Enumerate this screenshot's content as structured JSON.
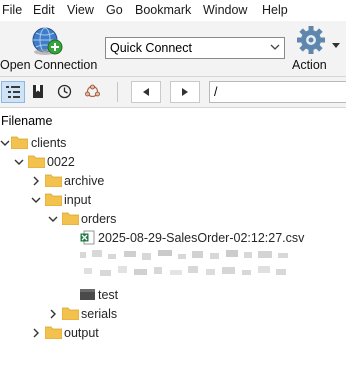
{
  "menu": [
    "File",
    "Edit",
    "View",
    "Go",
    "Bookmark",
    "Window",
    "Help"
  ],
  "toolbar": {
    "open_connection_label": "Open Connection",
    "quick_connect_value": "Quick Connect",
    "action_label": "Action"
  },
  "navigation": {
    "path_value": "/"
  },
  "browser": {
    "column_header": "Filename",
    "tree": [
      {
        "label": "clients",
        "type": "folder",
        "expanded": true
      },
      {
        "label": "0022",
        "type": "folder",
        "expanded": true
      },
      {
        "label": "archive",
        "type": "folder",
        "expanded": false
      },
      {
        "label": "input",
        "type": "folder",
        "expanded": true
      },
      {
        "label": "orders",
        "type": "folder",
        "expanded": true
      },
      {
        "label": "2025-08-29-SalesOrder-02:12:27.csv",
        "type": "csv-file"
      },
      {
        "label": "test",
        "type": "file"
      },
      {
        "label": "serials",
        "type": "folder",
        "expanded": false
      },
      {
        "label": "output",
        "type": "folder",
        "expanded": false
      }
    ]
  },
  "colors": {
    "folder": "#f2c14e",
    "folder_dark": "#d9a327",
    "excel_green": "#1d7a43",
    "active_tab_bg": "#cfe3f7"
  }
}
